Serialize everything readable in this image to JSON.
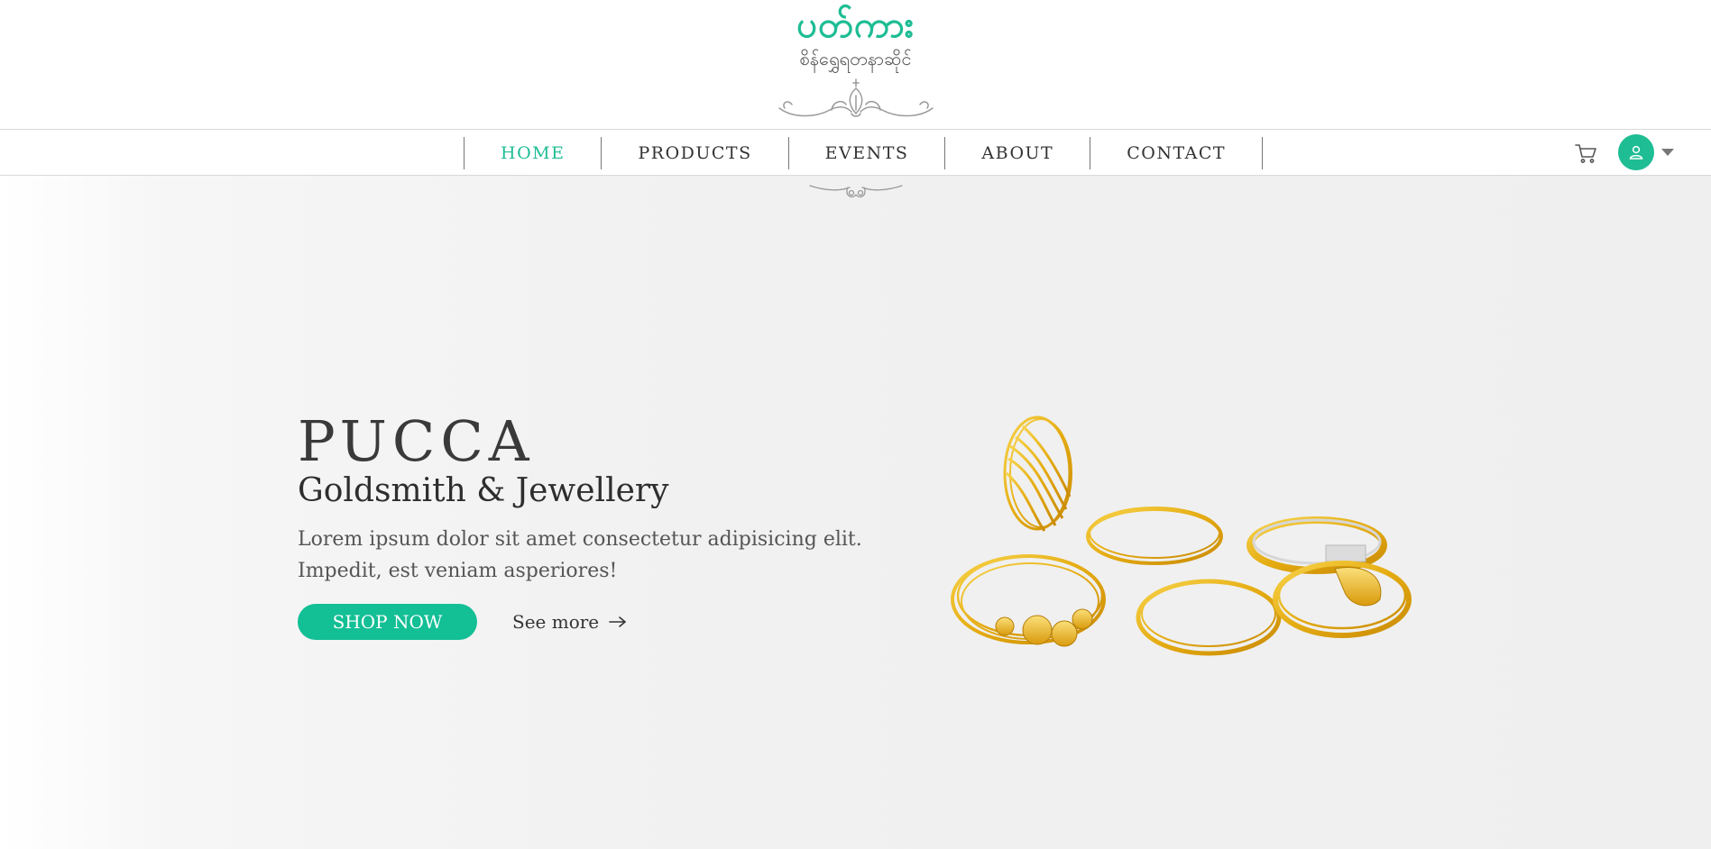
{
  "brand": {
    "logo_text": "ပတ်ကား",
    "logo_subtitle": "စိန်ရွှေရတနာဆိုင်"
  },
  "nav": {
    "items": [
      {
        "label": "HOME",
        "active": true
      },
      {
        "label": "PRODUCTS",
        "active": false
      },
      {
        "label": "EVENTS",
        "active": false
      },
      {
        "label": "ABOUT",
        "active": false
      },
      {
        "label": "CONTACT",
        "active": false
      }
    ],
    "icons": [
      "cart-icon",
      "user-icon",
      "caret-down-icon"
    ]
  },
  "hero": {
    "title": "PUCCA",
    "subtitle": "Goldsmith & Jewellery",
    "description": "Lorem ipsum dolor sit amet consectetur adipisicing elit. Impedit, est veniam asperiores!",
    "primary_button": "SHOP NOW",
    "secondary_link": "See more",
    "secondary_icon": "arrow-right-icon",
    "image": "gold-bangles-image"
  },
  "colors": {
    "accent": "#1ebd94",
    "button": "#13bf95",
    "text": "#333333",
    "gold": "#e8b51b"
  }
}
